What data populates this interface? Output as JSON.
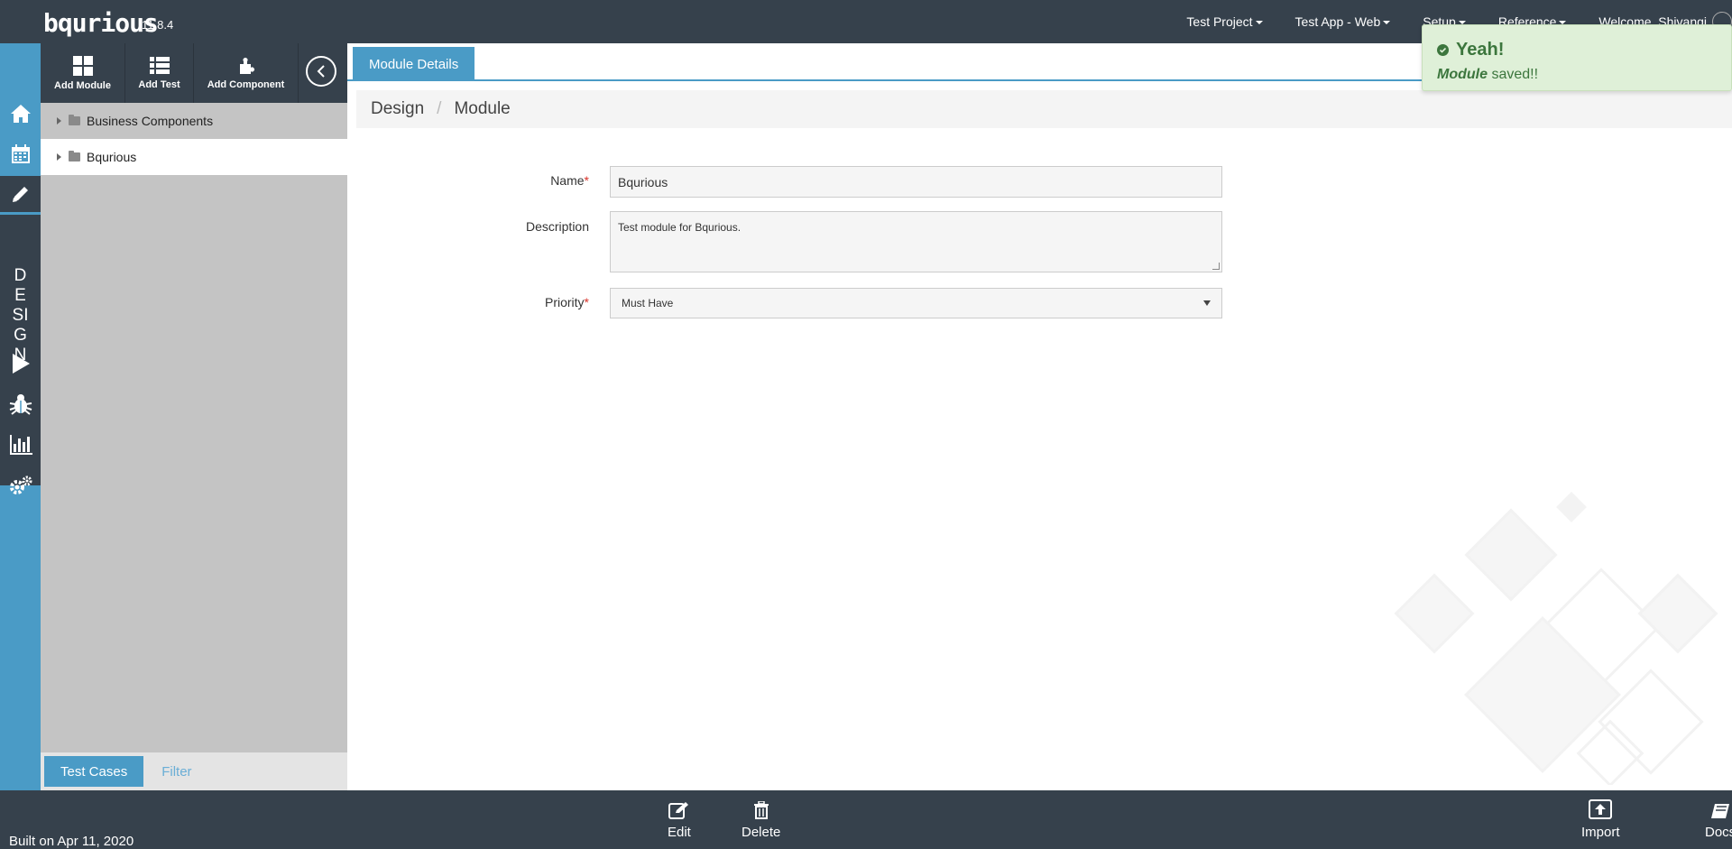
{
  "app": {
    "logo_text": "bqurious",
    "version": "11.8.4"
  },
  "topnav": {
    "project": "Test Project",
    "app": "Test App - Web",
    "setup": "Setup",
    "reference": "Reference",
    "welcome": "Welcome, Shivangi"
  },
  "sidebar": {
    "section_letters": [
      "D",
      "E",
      "SI",
      "G",
      "N"
    ],
    "icons": [
      "home-icon",
      "calendar-icon",
      "pencil-icon",
      "play-icon",
      "bug-icon",
      "bar-chart-icon",
      "gears-icon"
    ]
  },
  "tree_toolbar": {
    "add_module": "Add Module",
    "add_test": "Add Test",
    "add_component": "Add Component"
  },
  "tree": {
    "nodes": [
      {
        "label": "Business Components",
        "selected": false
      },
      {
        "label": "Bqurious",
        "selected": true
      }
    ],
    "tabs": {
      "active": "Test Cases",
      "inactive": "Filter"
    }
  },
  "main": {
    "tab": "Module Details",
    "breadcrumb": [
      "Design",
      "Module"
    ],
    "form": {
      "name_label": "Name",
      "name_value": "Bqurious",
      "description_label": "Description",
      "description_value": "Test module for Bqurious.",
      "priority_label": "Priority",
      "priority_value": "Must Have",
      "required_mark": "*"
    }
  },
  "toast": {
    "title": "Yeah!",
    "message_bold": "Module",
    "message_rest": " saved!!"
  },
  "footer": {
    "edit": "Edit",
    "delete": "Delete",
    "import": "Import",
    "docs": "Docs",
    "built": "Built on Apr 11, 2020"
  },
  "colors": {
    "topbar": "#36414c",
    "accent": "#4a9bc6",
    "tree_bg": "#c4c4c4",
    "toast_bg": "#dff0d8",
    "toast_text": "#3c763d"
  }
}
